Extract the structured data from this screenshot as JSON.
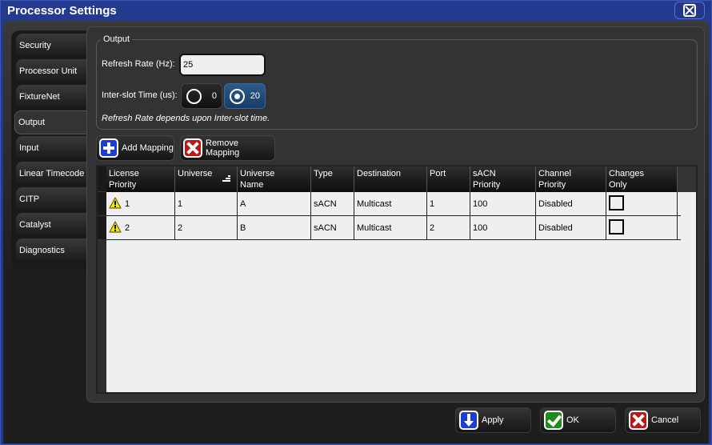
{
  "window": {
    "title": "Processor Settings",
    "close_icon": "close-icon"
  },
  "sidebar": {
    "active": "Output",
    "items": [
      {
        "label": "Security"
      },
      {
        "label": "Processor Unit"
      },
      {
        "label": "FixtureNet"
      },
      {
        "label": "Output"
      },
      {
        "label": "Input"
      },
      {
        "label": "Linear Timecode"
      },
      {
        "label": "CITP"
      },
      {
        "label": "Catalyst"
      },
      {
        "label": "Diagnostics"
      }
    ]
  },
  "output_group": {
    "legend": "Output",
    "refresh_rate_label": "Refresh Rate (Hz):",
    "refresh_rate_value": "25",
    "interslot_label": "Inter-slot Time (us):",
    "interslot_options": [
      {
        "value": "0",
        "selected": false
      },
      {
        "value": "20",
        "selected": true
      }
    ],
    "note": "Refresh Rate depends upon Inter-slot time."
  },
  "toolbar": {
    "add_label": "Add Mapping",
    "remove_label": "Remove Mapping"
  },
  "table": {
    "columns": [
      {
        "label": "License Priority",
        "l1": "License",
        "l2": "Priority"
      },
      {
        "label": "Universe",
        "l1": "Universe",
        "l2": "",
        "sorted": true
      },
      {
        "label": "Universe Name",
        "l1": "Universe",
        "l2": "Name"
      },
      {
        "label": "Type",
        "l1": "Type",
        "l2": ""
      },
      {
        "label": "Destination",
        "l1": "Destination",
        "l2": ""
      },
      {
        "label": "Port",
        "l1": "Port",
        "l2": ""
      },
      {
        "label": "sACN Priority",
        "l1": "sACN",
        "l2": "Priority"
      },
      {
        "label": "Channel Priority",
        "l1": "Channel",
        "l2": "Priority"
      },
      {
        "label": "Changes Only",
        "l1": "Changes",
        "l2": "Only"
      }
    ],
    "rows": [
      {
        "license_priority": "1",
        "warning": true,
        "universe": "1",
        "universe_name": "A",
        "type": "sACN",
        "destination": "Multicast",
        "port": "1",
        "sacn_priority": "100",
        "channel_priority": "Disabled",
        "changes_only": false
      },
      {
        "license_priority": "2",
        "warning": true,
        "universe": "2",
        "universe_name": "B",
        "type": "sACN",
        "destination": "Multicast",
        "port": "2",
        "sacn_priority": "100",
        "channel_priority": "Disabled",
        "changes_only": false
      }
    ]
  },
  "footer": {
    "apply_label": "Apply",
    "ok_label": "OK",
    "cancel_label": "Cancel"
  },
  "colors": {
    "title_bar": "#233a8e",
    "selected_radio": "#1f4a7a",
    "add_icon": "#1a3fd0",
    "remove_icon": "#c01515",
    "ok_icon": "#1c8c1c",
    "warning": "#f5e400"
  }
}
